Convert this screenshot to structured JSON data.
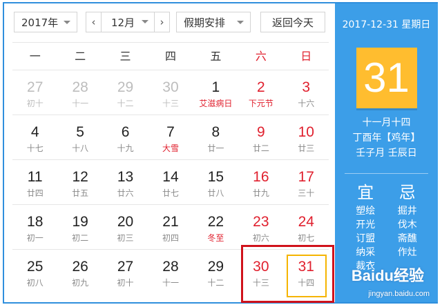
{
  "toolbar": {
    "year": "2017年",
    "month": "12月",
    "prev": "‹",
    "next": "›",
    "holiday": "假期安排",
    "today": "返回今天"
  },
  "weekdays": [
    "一",
    "二",
    "三",
    "四",
    "五",
    "六",
    "日"
  ],
  "weeks": [
    [
      {
        "d": "27",
        "l": "初十",
        "other": true
      },
      {
        "d": "28",
        "l": "十一",
        "other": true
      },
      {
        "d": "29",
        "l": "十二",
        "other": true
      },
      {
        "d": "30",
        "l": "十三",
        "other": true
      },
      {
        "d": "1",
        "l": "艾滋病日",
        "fest": true
      },
      {
        "d": "2",
        "l": "下元节",
        "fest": true,
        "wkend": true
      },
      {
        "d": "3",
        "l": "十六",
        "wkend": true
      }
    ],
    [
      {
        "d": "4",
        "l": "十七"
      },
      {
        "d": "5",
        "l": "十八"
      },
      {
        "d": "6",
        "l": "十九"
      },
      {
        "d": "7",
        "l": "大雪",
        "fest": true
      },
      {
        "d": "8",
        "l": "廿一"
      },
      {
        "d": "9",
        "l": "廿二",
        "wkend": true
      },
      {
        "d": "10",
        "l": "廿三",
        "wkend": true
      }
    ],
    [
      {
        "d": "11",
        "l": "廿四"
      },
      {
        "d": "12",
        "l": "廿五"
      },
      {
        "d": "13",
        "l": "廿六"
      },
      {
        "d": "14",
        "l": "廿七"
      },
      {
        "d": "15",
        "l": "廿八"
      },
      {
        "d": "16",
        "l": "廿九",
        "wkend": true
      },
      {
        "d": "17",
        "l": "三十",
        "wkend": true
      }
    ],
    [
      {
        "d": "18",
        "l": "初一"
      },
      {
        "d": "19",
        "l": "初二"
      },
      {
        "d": "20",
        "l": "初三"
      },
      {
        "d": "21",
        "l": "初四"
      },
      {
        "d": "22",
        "l": "冬至",
        "fest": true
      },
      {
        "d": "23",
        "l": "初六",
        "wkend": true
      },
      {
        "d": "24",
        "l": "初七",
        "wkend": true
      }
    ],
    [
      {
        "d": "25",
        "l": "初八"
      },
      {
        "d": "26",
        "l": "初九"
      },
      {
        "d": "27",
        "l": "初十"
      },
      {
        "d": "28",
        "l": "十一"
      },
      {
        "d": "29",
        "l": "十二"
      },
      {
        "d": "30",
        "l": "十三",
        "wkend": true
      },
      {
        "d": "31",
        "l": "十四",
        "wkend": true,
        "selected": true
      }
    ]
  ],
  "side": {
    "date_line": "2017-12-31 星期日",
    "big_day": "31",
    "lunar_date": "十一月十四",
    "lunar_year": "丁酉年【鸡年】",
    "ganzhi": "壬子月 壬辰日",
    "yi_label": "宜",
    "ji_label": "忌",
    "yi_items": [
      "塑绘",
      "开光",
      "订盟",
      "纳采",
      "裁衣"
    ],
    "ji_items": [
      "掘井",
      "伐木",
      "斋醮",
      "作灶"
    ]
  },
  "watermark": {
    "brand": "Baidu经验",
    "url": "jingyan.baidu.com"
  },
  "colors": {
    "accent_blue": "#3c9ee8",
    "weekend_red": "#e0202e",
    "today_yellow": "#ffbd2f",
    "highlight_red": "#d0121b"
  }
}
